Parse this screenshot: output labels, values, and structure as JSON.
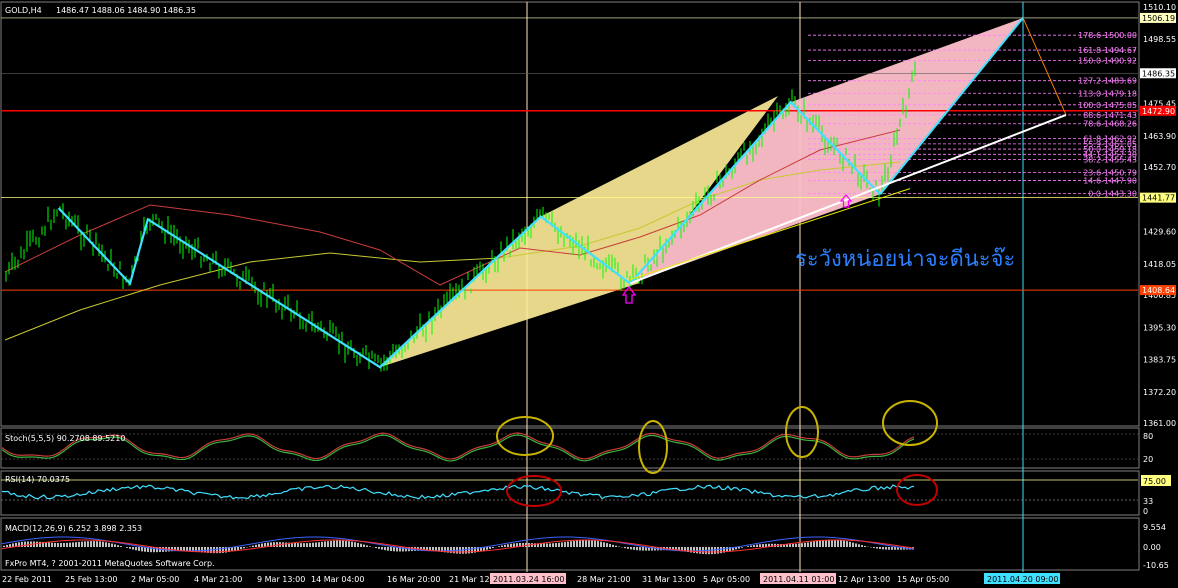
{
  "header": {
    "symbol": "GOLD,H4",
    "ohlc": "1486.47 1488.06 1484.90 1486.35"
  },
  "price_axis": {
    "labels": [
      "1510.10",
      "1498.55",
      "1486.35",
      "1475.45",
      "1463.90",
      "1452.70",
      "1441.77",
      "1429.60",
      "1418.05",
      "1406.85",
      "1395.30",
      "1383.75",
      "1372.20",
      "1361.00"
    ],
    "boxed": [
      {
        "text": "1506.19",
        "price": 1506.19,
        "bg": "#ffffc0",
        "fg": "#000000"
      },
      {
        "text": "1486.35",
        "price": 1486.35,
        "bg": "#ffffff",
        "fg": "#000000"
      },
      {
        "text": "1472.90",
        "price": 1472.9,
        "bg": "#ff0000",
        "fg": "#ffffff"
      },
      {
        "text": "1441.77",
        "price": 1441.77,
        "bg": "#ffff80",
        "fg": "#000000"
      },
      {
        "text": "1408.64",
        "price": 1408.64,
        "bg": "#ff4000",
        "fg": "#ffffff"
      }
    ]
  },
  "fib_levels": [
    "178.6-1500.00",
    "161.8-1494.67",
    "150.0-1490.92",
    "127.2-1483.69",
    "113.0-1479.18",
    "100.0-1475.05",
    "88.6-1471.43",
    "78.6-1468.26",
    "61.8-1462.92",
    "55.9-1461.05",
    "50.0-1459.18",
    "44.1-1457.30",
    "38.2-1455.43",
    "23.6-1450.79",
    "14.6-1447.90",
    "0.0-1443.30"
  ],
  "annotation": "ระวังหน่อยน่าจะดีนะจ๊ะ",
  "indicators": {
    "stoch": {
      "label": "Stoch(5,5,5) 90.2708 89.5210",
      "levels": [
        "80",
        "20"
      ]
    },
    "rsi": {
      "label": "RSI(14) 70.0375",
      "levels": [
        "75.00",
        "33",
        "0"
      ]
    },
    "macd": {
      "label": "MACD(12,26,9) 6.252 3.898 2.353",
      "levels": [
        "9.554",
        "0.00",
        "-10.65"
      ]
    }
  },
  "time_axis": {
    "labels": [
      "22 Feb 2011",
      "25 Feb 13:00",
      "2 Mar 05:00",
      "4 Mar 21:00",
      "9 Mar 13:00",
      "14 Mar 04:00",
      "16 Mar 20:00",
      "21 Mar 12",
      "28 Mar 21:00",
      "31 Mar 13:00",
      "5 Apr 05:00",
      "12 Apr 13:00",
      "15 Apr 05:00"
    ],
    "highlights": [
      {
        "text": "2011.03.24 16:00",
        "color": "#ffc0cb"
      },
      {
        "text": "2011.04.11 01:00",
        "color": "#ffc0cb"
      },
      {
        "text": "2011.04.20 09:00",
        "color": "#40e0ff"
      }
    ]
  },
  "footer": "FxPro MT4, ? 2001-2011 MetaQuotes Software Corp.",
  "colors": {
    "candle": "#00ff00",
    "zigzag": "#40e0ff",
    "fill1": "#ffee99",
    "fill2": "#ffc0cb",
    "ma1": "#c8c832",
    "ma2": "#c83c3c",
    "hline": "#ff0000"
  },
  "chart_data": {
    "type": "candlestick",
    "symbol": "GOLD",
    "timeframe": "H4",
    "ylim": [
      1361.0,
      1510.1
    ],
    "zigzag": [
      {
        "time": "22 Feb 2011",
        "price": 1413
      },
      {
        "time": "25 Feb",
        "price": 1438
      },
      {
        "time": "1 Mar",
        "price": 1411
      },
      {
        "time": "2 Mar",
        "price": 1434
      },
      {
        "time": "15 Mar",
        "price": 1381
      },
      {
        "time": "24 Mar",
        "price": 1435
      },
      {
        "time": "29 Mar",
        "price": 1411
      },
      {
        "time": "7 Apr",
        "price": 1476
      },
      {
        "time": "12 Apr",
        "price": 1443
      },
      {
        "time": "20 Apr",
        "price": 1506.19
      }
    ],
    "current_price": 1486.35,
    "ohlc_last": {
      "open": 1486.47,
      "high": 1488.06,
      "low": 1484.9,
      "close": 1486.35
    },
    "horizontal_lines": [
      1472.9,
      1441.77,
      1408.64
    ],
    "stoch": {
      "k": 90.2708,
      "d": 89.521
    },
    "rsi": 70.0375,
    "macd": {
      "main": 6.252,
      "signal": 3.898,
      "hist": 2.353
    }
  }
}
